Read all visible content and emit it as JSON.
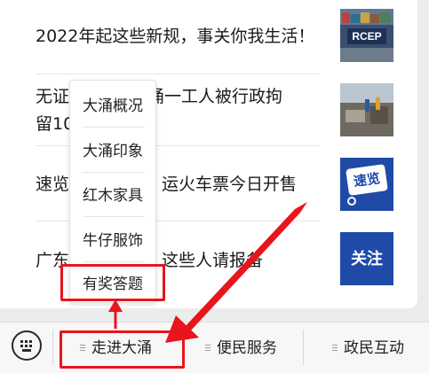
{
  "articles": [
    {
      "title": "2022年起这些新规，事关你我生活！",
      "thumb_text": "RCEP"
    },
    {
      "title_line1": "无证伐",
      "title_line1_rest": "X，大涌一工人被行政拘",
      "title_line2": "留10"
    },
    {
      "title_left": "速览：",
      "title_right": "运火车票今日开售",
      "thumb_text": "速览"
    },
    {
      "title_left": "广东对",
      "title_right": "这些人请报备",
      "thumb_text": "关注"
    }
  ],
  "popup_menu": {
    "items": [
      "大涌概况",
      "大涌印象",
      "红木家具",
      "牛仔服饰",
      "有奖答题"
    ]
  },
  "bottom_menu": {
    "tabs": [
      "走进大涌",
      "便民服务",
      "政民互动"
    ]
  },
  "colors": {
    "highlight": "#e8151c",
    "thumb_blue": "#1f4aa8"
  },
  "icons": [
    "keyboard-icon",
    "menu-lines-icon",
    "arrow-icon"
  ]
}
